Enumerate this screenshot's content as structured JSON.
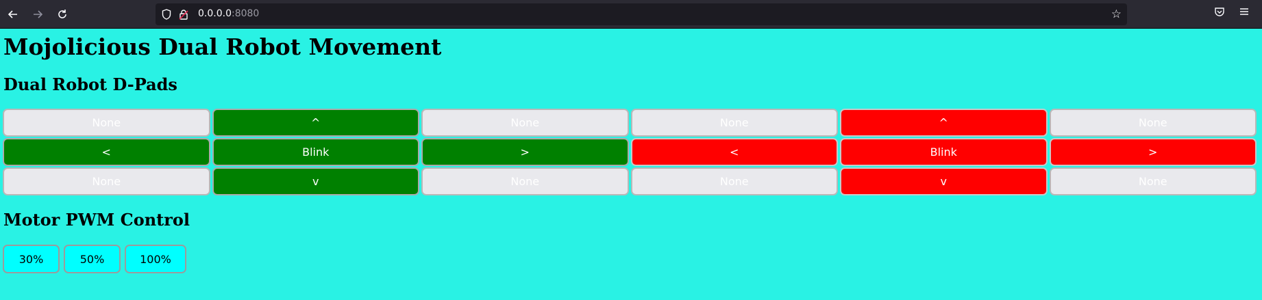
{
  "browser": {
    "url_host": "0.0.0.0",
    "url_port": ":8080",
    "icons": {
      "back": "back-arrow-icon",
      "forward": "forward-arrow-icon",
      "reload": "reload-icon",
      "shield": "shield-icon",
      "lock": "lock-icon",
      "bookmark": "star-icon",
      "pocket": "pocket-icon",
      "menu": "hamburger-menu-icon"
    }
  },
  "page": {
    "title": "Mojolicious Dual Robot Movement",
    "dpads_heading": "Dual Robot D-Pads",
    "pwm_heading": "Motor PWM Control",
    "colors": {
      "background": "#29f2e4",
      "robot1": "#008000",
      "robot2": "#ff0000",
      "none": "#e9e9ed",
      "pwm": "#00ffff"
    },
    "dpad_rows": [
      [
        {
          "label": "None",
          "style": "none"
        },
        {
          "label": "^",
          "style": "green"
        },
        {
          "label": "None",
          "style": "none"
        },
        {
          "label": "None",
          "style": "none"
        },
        {
          "label": "^",
          "style": "red"
        },
        {
          "label": "None",
          "style": "none"
        }
      ],
      [
        {
          "label": "<",
          "style": "green"
        },
        {
          "label": "Blink",
          "style": "green"
        },
        {
          "label": ">",
          "style": "green"
        },
        {
          "label": "<",
          "style": "red"
        },
        {
          "label": "Blink",
          "style": "red"
        },
        {
          "label": ">",
          "style": "red"
        }
      ],
      [
        {
          "label": "None",
          "style": "none"
        },
        {
          "label": "v",
          "style": "green"
        },
        {
          "label": "None",
          "style": "none"
        },
        {
          "label": "None",
          "style": "none"
        },
        {
          "label": "v",
          "style": "red"
        },
        {
          "label": "None",
          "style": "none"
        }
      ]
    ],
    "pwm_buttons": [
      "30%",
      "50%",
      "100%"
    ]
  }
}
